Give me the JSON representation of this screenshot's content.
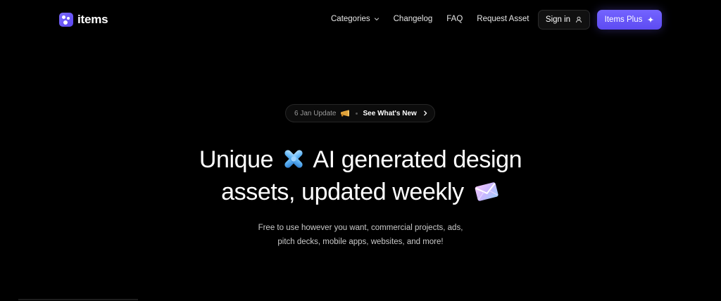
{
  "brand": {
    "name": "items",
    "logo_icon": "items-logo-icon",
    "accent": "#6b5bff"
  },
  "nav": {
    "links": [
      {
        "label": "Categories",
        "has_dropdown": true
      },
      {
        "label": "Changelog"
      },
      {
        "label": "FAQ"
      },
      {
        "label": "Request Asset"
      }
    ],
    "sign_in_label": "Sign in",
    "sign_in_icon": "user-icon",
    "plus_label": "Items Plus",
    "plus_icon": "sparkle-icon"
  },
  "hero": {
    "update_pill": {
      "date": "6 Jan Update",
      "icon": "megaphone-icon",
      "cta": "See What's New",
      "arrow_icon": "chevron-right-icon"
    },
    "headline_line1_before": "Unique",
    "headline_line1_emoji": "x-emoji-icon",
    "headline_line1_after": "AI generated design",
    "headline_line2": "assets, updated weekly",
    "headline_line2_emoji": "envelope-emoji-icon",
    "subtext_line1": "Free to use however you want, commercial projects, ads,",
    "subtext_line2": "pitch decks, mobile apps, websites, and more!"
  },
  "colors": {
    "background": "#000000",
    "text": "#ffffff",
    "muted": "#c9c9c9",
    "primary_button": "#6b5bff"
  }
}
